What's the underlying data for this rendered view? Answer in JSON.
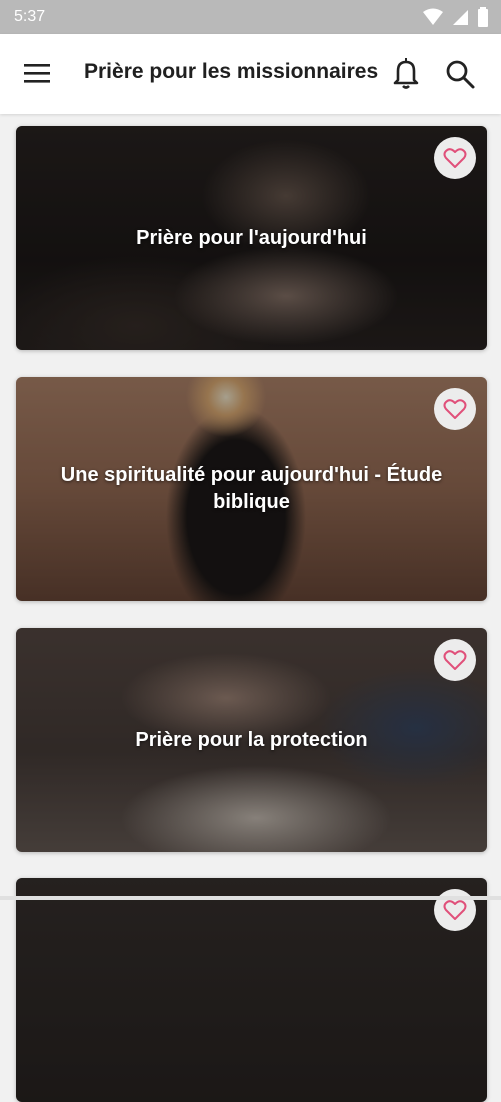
{
  "status_bar": {
    "time": "5:37"
  },
  "app_bar": {
    "title": "Prière pour les missionnaires",
    "menu_icon": "menu-icon",
    "notification_icon": "bell-icon",
    "search_icon": "search-icon"
  },
  "cards": [
    {
      "title": "Prière pour l'aujourd'hui",
      "favorite_icon": "heart-outline-icon"
    },
    {
      "title": "Une spiritualité pour aujourd'hui - Étude biblique",
      "favorite_icon": "heart-outline-icon"
    },
    {
      "title": "Prière pour la protection",
      "favorite_icon": "heart-outline-icon"
    },
    {
      "title": "",
      "favorite_icon": "heart-outline-icon"
    }
  ],
  "colors": {
    "app_bar_bg": "#ffffff",
    "status_bar_bg": "#b9b9b9",
    "heart": "#e0507a"
  }
}
